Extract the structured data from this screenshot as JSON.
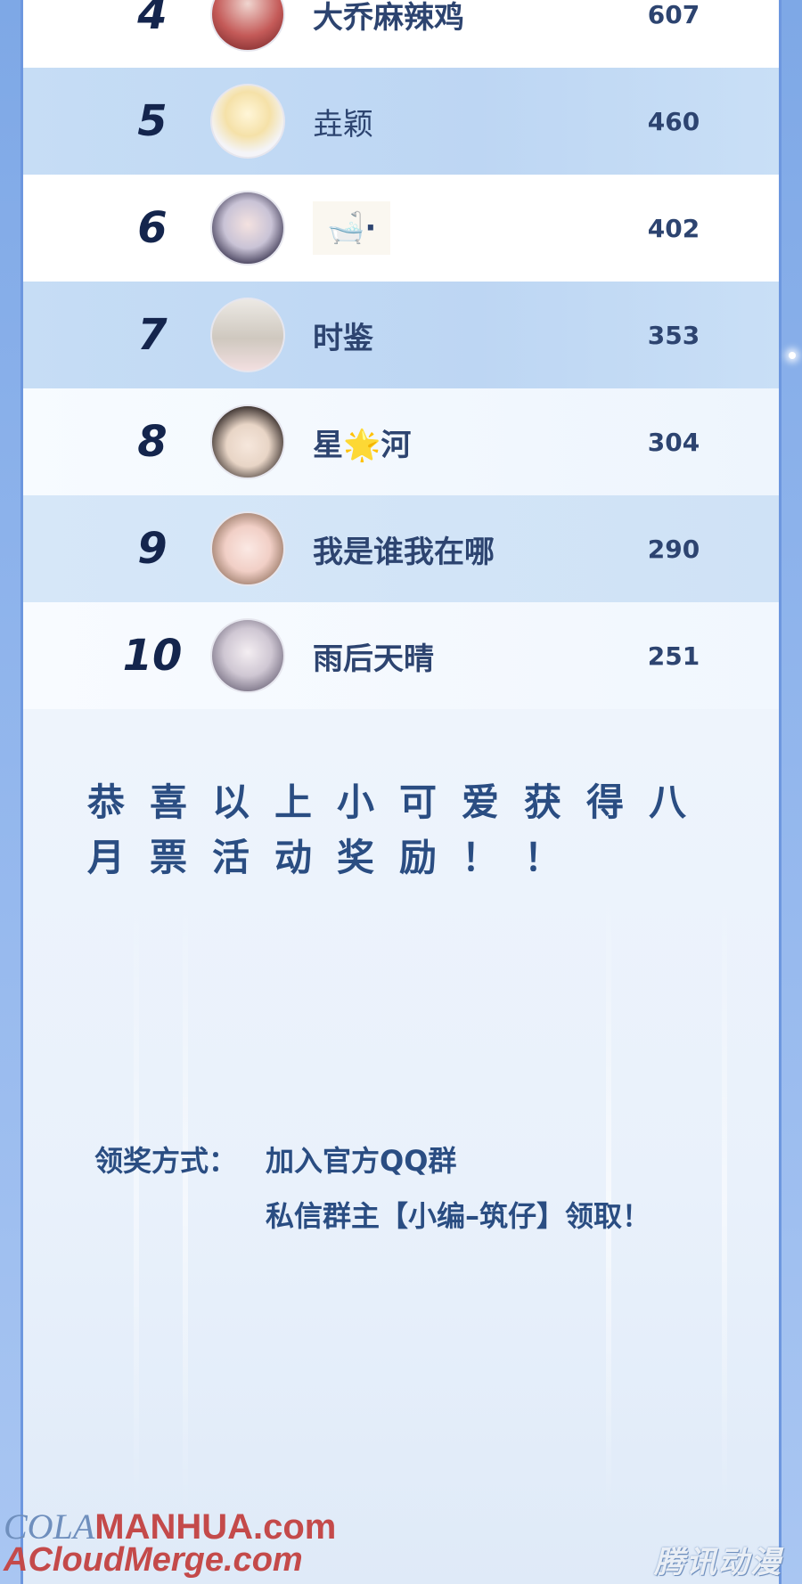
{
  "leaderboard": {
    "rows": [
      {
        "rank": "4",
        "name": "大乔麻辣鸡",
        "votes": "607"
      },
      {
        "rank": "5",
        "name": "垚颖",
        "votes": "460"
      },
      {
        "rank": "6",
        "name": "🛁·",
        "votes": "402"
      },
      {
        "rank": "7",
        "name": "时鉴",
        "votes": "353"
      },
      {
        "rank": "8",
        "name": "星🌟河",
        "votes": "304"
      },
      {
        "rank": "9",
        "name": "我是谁我在哪",
        "votes": "290"
      },
      {
        "rank": "10",
        "name": "雨后天晴",
        "votes": "251"
      }
    ]
  },
  "congrats": {
    "line1": "恭喜以上小可爱获得八月",
    "line2": "月票活动奖励！！"
  },
  "claim": {
    "label": "领奖方式：",
    "line1": "加入官方QQ群",
    "line2": "私信群主【小编–筑仔】领取！"
  },
  "watermarks": {
    "site1_prefix": "COLA",
    "site1_brand": "MANHUA.com",
    "site2": "ACloudMerge.com",
    "publisher": "腾讯动漫"
  },
  "colors": {
    "accent": "#2d4470",
    "row_highlight": "#c6ddf5",
    "frame": "#6d97df"
  }
}
